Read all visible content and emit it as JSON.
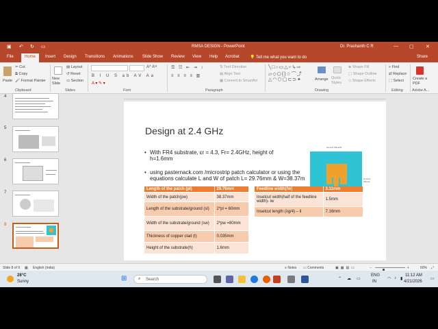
{
  "window": {
    "title": "RMSA DESIGN",
    "app": "PowerPoint",
    "user": "Dr. Prashanth C R",
    "controls": {
      "minimize": "—",
      "maximize": "▢",
      "close": "✕"
    }
  },
  "tabs": [
    "File",
    "Home",
    "Insert",
    "Design",
    "Transitions",
    "Animations",
    "Slide Show",
    "Review",
    "View",
    "Help",
    "Acrobat"
  ],
  "active_tab": "Home",
  "tell_me": "Tell me what you want to do",
  "share": "Share",
  "ribbon": {
    "clipboard": {
      "paste": "Paste",
      "cut": "Cut",
      "copy": "Copy",
      "format_painter": "Format Painter",
      "group": "Clipboard"
    },
    "slides": {
      "new_slide": "New Slide",
      "layout": "Layout",
      "reset": "Reset",
      "section": "Section",
      "group": "Slides"
    },
    "font": {
      "group": "Font"
    },
    "paragraph": {
      "text_direction": "Text Direction",
      "align_text": "Align Text",
      "convert_smartart": "Convert to SmartArt",
      "group": "Paragraph"
    },
    "drawing": {
      "arrange": "Arrange",
      "quick_styles": "Quick Styles",
      "shape_fill": "Shape Fill",
      "shape_outline": "Shape Outline",
      "shape_effects": "Shape Effects",
      "group": "Drawing"
    },
    "editing": {
      "find": "Find",
      "replace": "Replace",
      "select": "Select",
      "group": "Editing"
    },
    "adobe": {
      "create_pdf": "Create a PDF",
      "group": "Adobe A..."
    }
  },
  "thumbnails": {
    "numbers": [
      "4",
      "5",
      "6",
      "7",
      "8"
    ],
    "selected": "8"
  },
  "slide": {
    "title": "Design at 2.4 GHz",
    "bullet1_line1": "With FR4 substrate,  εr = 4.3, Fr= 2.4GHz, height of",
    "bullet1_line2": "h=1.6mm",
    "bullet2_line1": "using pasternack.com /microstrip patch calculator or using the",
    "bullet2_line2": "equations calculate L and W of patch L= 29.76mm & W=38.37mm",
    "figure_labels": {
      "top": "Ground Plane/W",
      "right": "Ground Plane/L"
    },
    "table1": [
      [
        "Length of the patch (pl)",
        "29.76mm"
      ],
      [
        "Width of the patch(pw)",
        "38.37mm"
      ],
      [
        "Length of the substrate/ground (sl)",
        "2*pl = 60mm"
      ],
      [
        "Width of the substrate/ground (sw)",
        "2*pw =80mm"
      ],
      [
        "Thickness of copper clad (t)",
        "0.035mm"
      ],
      [
        "Height of the substrate(h)",
        "1.6mm"
      ]
    ],
    "table2": [
      [
        "Feedline width(fw)",
        "3.11mm"
      ],
      [
        "Insetcut width(half of the feedline width)- iw",
        "1.5mm"
      ],
      [
        "Insetcut length (λg/4) – il",
        "7.16mm"
      ]
    ]
  },
  "status": {
    "slide_of": "Slide 8 of 9",
    "language": "English (India)",
    "notes": "Notes",
    "comments": "Comments",
    "zoom": "60%",
    "zoom_level_pct": 60
  },
  "screencast": "screencast",
  "taskbar": {
    "temp": "28°C",
    "weather": "Sunny",
    "search": "Search",
    "lang": "ENG",
    "region": "IN",
    "time": "11:12 AM",
    "date": "4/21/2026"
  },
  "colors": {
    "accent": "#b7472a",
    "table_header": "#ed7d31",
    "table_row_light": "#fbe4d5",
    "table_row_dark": "#f8cbad",
    "substrate": "#2ec4d6",
    "patch": "#f0a02c"
  }
}
